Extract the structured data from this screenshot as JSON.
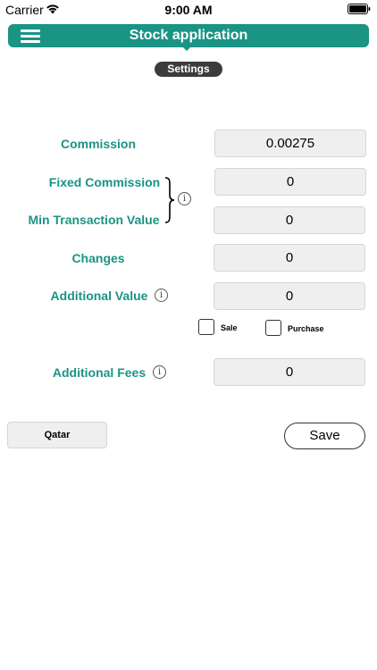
{
  "status_bar": {
    "carrier": "Carrier",
    "time": "9:00 AM"
  },
  "nav": {
    "title": "Stock application",
    "color": "#1a9484"
  },
  "settings_pill": "Settings",
  "form": {
    "commission": {
      "label": "Commission",
      "value": "0.00275"
    },
    "fixed_commission": {
      "label": "Fixed Commission",
      "value": "0"
    },
    "min_transaction_value": {
      "label": "Min Transaction Value",
      "value": "0"
    },
    "changes": {
      "label": "Changes",
      "value": "0"
    },
    "additional_value": {
      "label": "Additional Value",
      "value": "0"
    },
    "sale_checkbox": {
      "label": "Sale",
      "checked": false
    },
    "purchase_checkbox": {
      "label": "Purchase",
      "checked": false
    },
    "additional_fees": {
      "label": "Additional Fees",
      "value": "0"
    }
  },
  "buttons": {
    "country": "Qatar",
    "save": "Save"
  },
  "icons": {
    "info": "i",
    "menu": "hamburger-menu-icon",
    "wifi": "wifi-icon",
    "battery": "battery-icon"
  }
}
